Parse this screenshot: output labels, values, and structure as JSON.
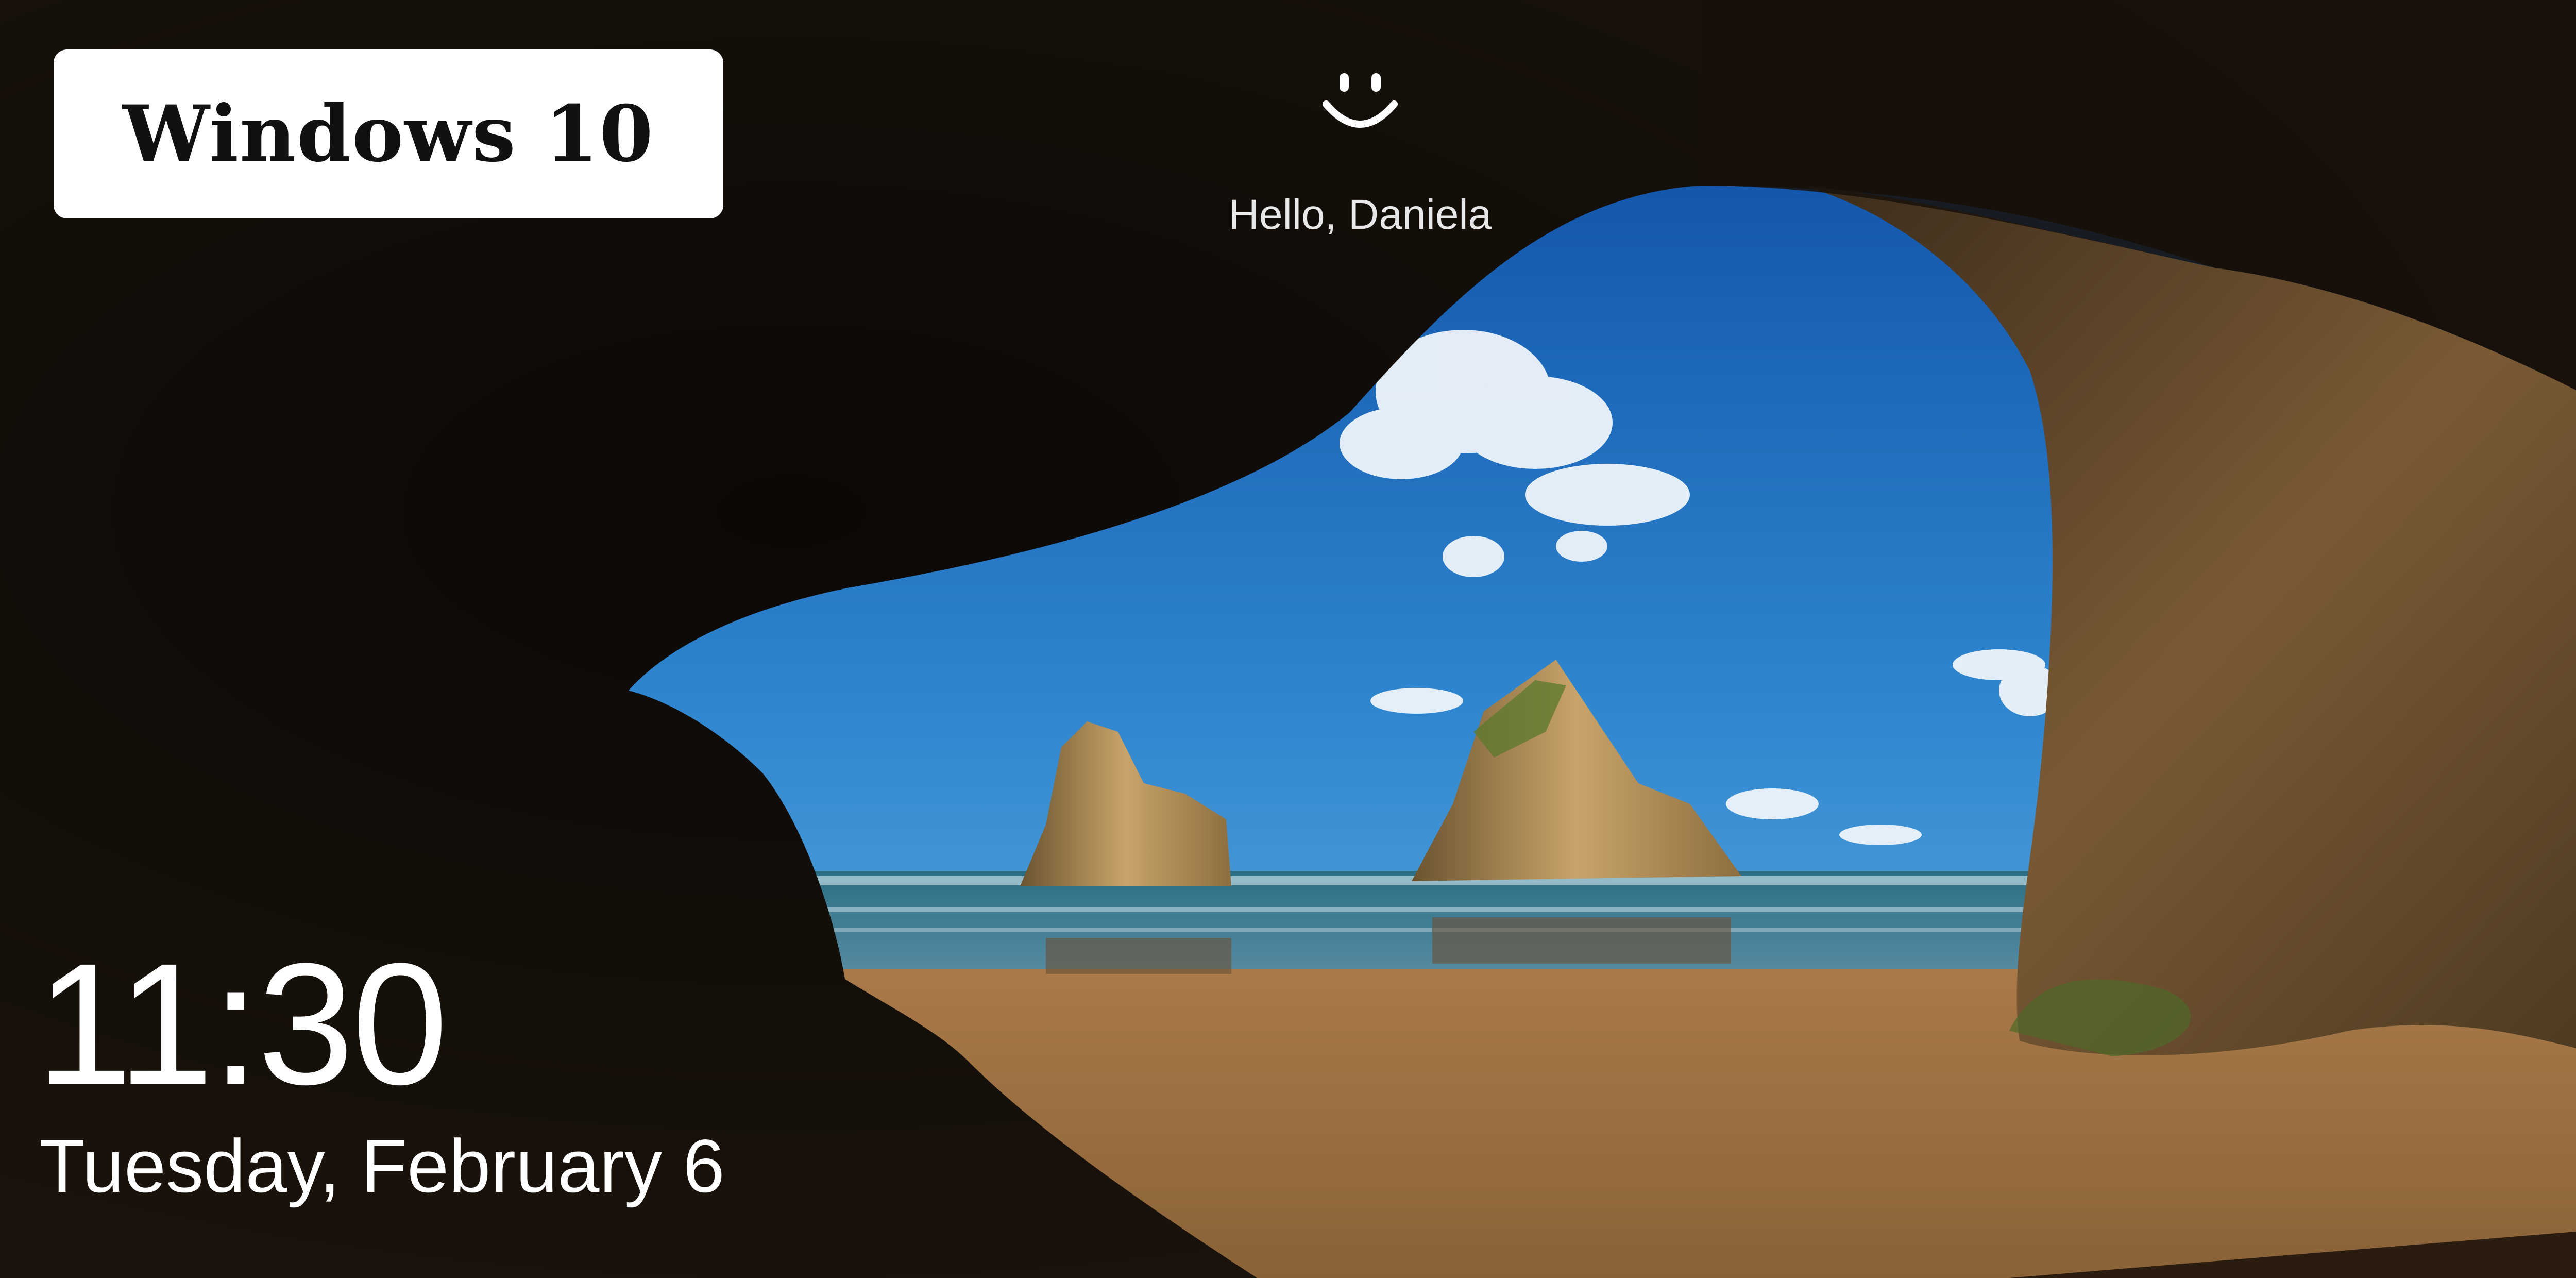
{
  "badge": {
    "label": "Windows 10"
  },
  "lock_screen": {
    "user_icon": "smiley-face-icon",
    "greeting": "Hello, Daniela",
    "time": "11:30",
    "date": "Tuesday, February 6"
  },
  "wallpaper": {
    "subject": "sea-cave-beach-wallpaper",
    "colors": {
      "sky_top": "#0a4da8",
      "sky_bottom": "#5aa6d8",
      "sand": "#b48250",
      "cave": "#1a140e",
      "rock": "#a07840"
    }
  }
}
